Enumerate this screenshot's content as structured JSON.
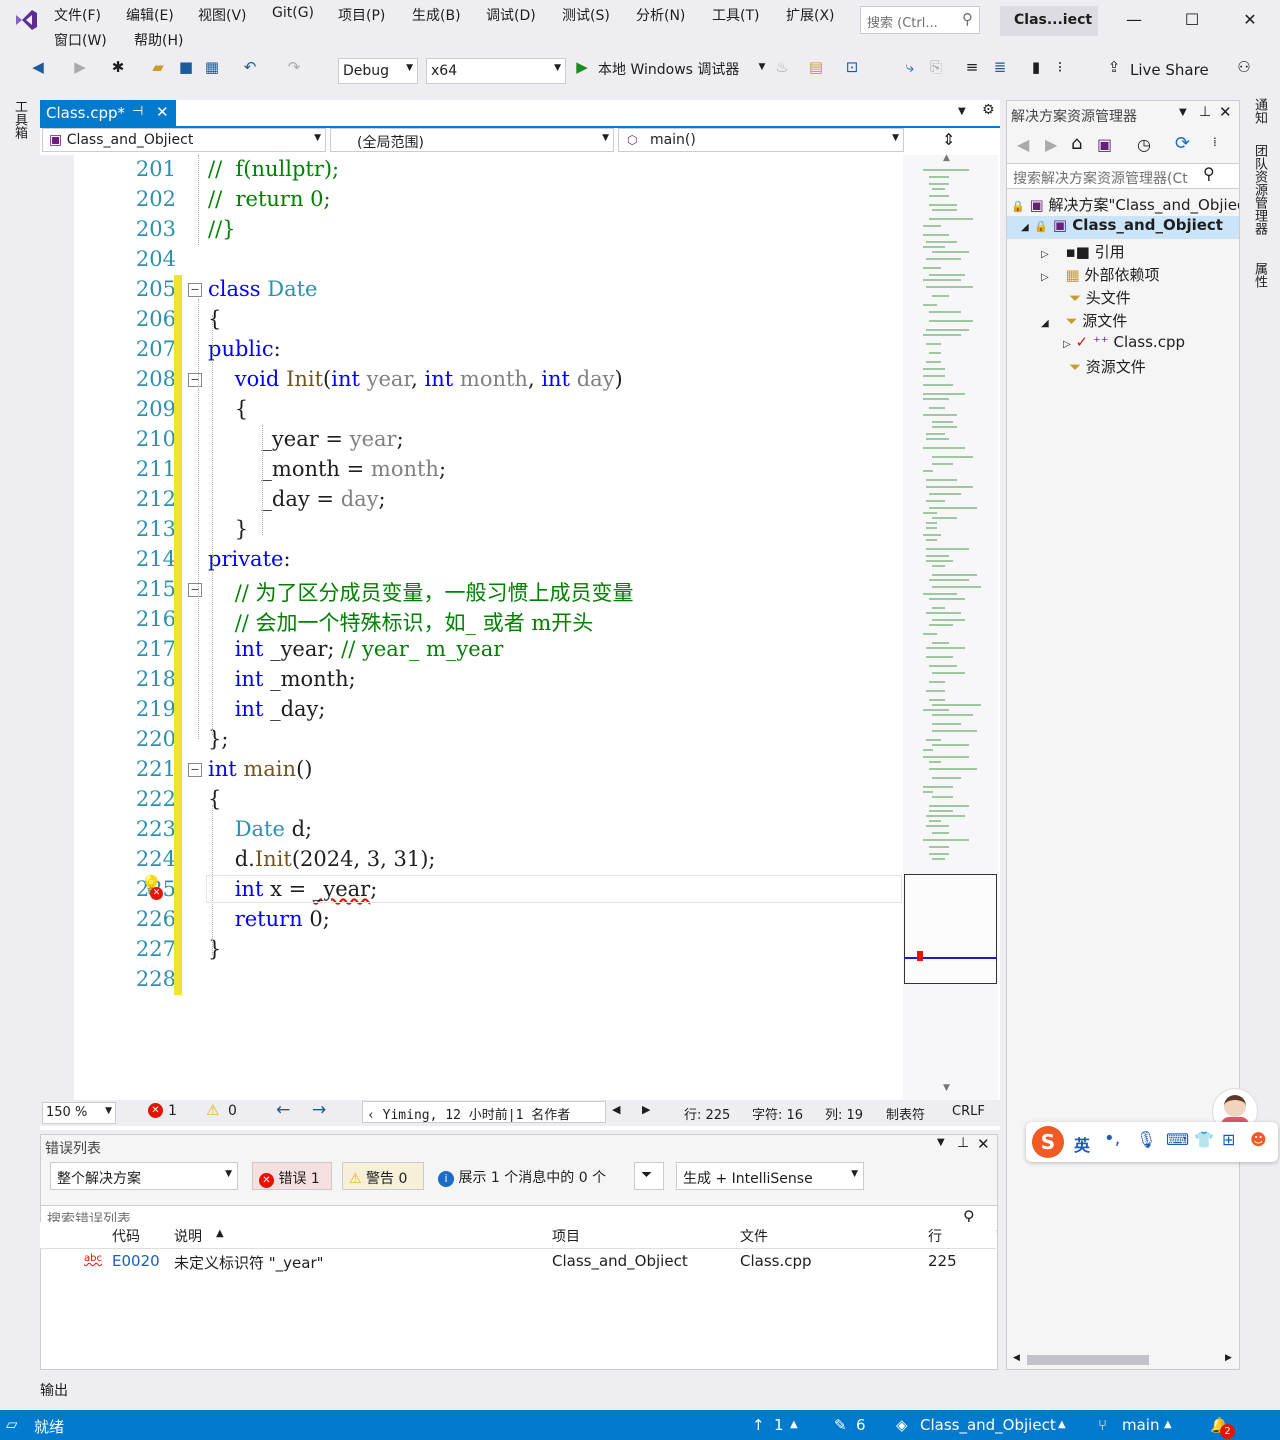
{
  "menu": {
    "items": [
      "文件(F)",
      "编辑(E)",
      "视图(V)",
      "Git(G)",
      "项目(P)",
      "生成(B)",
      "调试(D)",
      "测试(S)",
      "分析(N)",
      "工具(T)",
      "扩展(X)"
    ],
    "row2": [
      "窗口(W)",
      "帮助(H)"
    ],
    "search_placeholder": "搜索 (Ctrl...",
    "title": "Clas...iect"
  },
  "toolbar": {
    "config": "Debug",
    "platform": "x64",
    "run_label": "本地 Windows 调试器",
    "live_share": "Live Share"
  },
  "left_tool": "工具箱",
  "right_strip": [
    "通知",
    "团队资源管理器",
    "属性"
  ],
  "editor": {
    "tab_label": "Class.cpp*",
    "nav_project": "Class_and_Objiect",
    "nav_scope": "(全局范围)",
    "nav_member": "main()",
    "lines": [
      {
        "n": "201",
        "html": "<span class=\"cm\">//  f(nullptr);</span>"
      },
      {
        "n": "202",
        "html": "<span class=\"cm\">//  return 0;</span>"
      },
      {
        "n": "203",
        "html": "<span class=\"cm\">//}</span>"
      },
      {
        "n": "204",
        "html": ""
      },
      {
        "n": "205",
        "html": "<span class=\"kw\">class</span> <span class=\"cls\">Date</span>"
      },
      {
        "n": "206",
        "html": "{"
      },
      {
        "n": "207",
        "html": "<span class=\"kw\">public</span>:"
      },
      {
        "n": "208",
        "html": "    <span class=\"kw\">void</span> <span class=\"fn\">Init</span>(<span class=\"kw\">int</span> <span class=\"pm\">year</span>, <span class=\"kw\">int</span> <span class=\"pm\">month</span>, <span class=\"kw\">int</span> <span class=\"pm\">day</span>)"
      },
      {
        "n": "209",
        "html": "    {"
      },
      {
        "n": "210",
        "html": "        _year = <span class=\"pm\">year</span>;"
      },
      {
        "n": "211",
        "html": "        _month = <span class=\"pm\">month</span>;"
      },
      {
        "n": "212",
        "html": "        _day = <span class=\"pm\">day</span>;"
      },
      {
        "n": "213",
        "html": "    }"
      },
      {
        "n": "214",
        "html": "<span class=\"kw\">private</span>:"
      },
      {
        "n": "215",
        "html": "    <span class=\"cm\">// 为了区分成员变量，一般习惯上成员变量</span>"
      },
      {
        "n": "216",
        "html": "    <span class=\"cm\">// 会加一个特殊标识，如_ 或者 m开头</span>"
      },
      {
        "n": "217",
        "html": "    <span class=\"kw\">int</span> _year; <span class=\"cm\">// year_ m_year</span>"
      },
      {
        "n": "218",
        "html": "    <span class=\"kw\">int</span> _month;"
      },
      {
        "n": "219",
        "html": "    <span class=\"kw\">int</span> _day;"
      },
      {
        "n": "220",
        "html": "};"
      },
      {
        "n": "221",
        "html": "<span class=\"kw\">int</span> <span class=\"fn\">main</span>()"
      },
      {
        "n": "222",
        "html": "{"
      },
      {
        "n": "223",
        "html": "    <span class=\"cls\">Date</span> d;"
      },
      {
        "n": "224",
        "html": "    d.<span class=\"fn\">Init</span>(2024, 3, 31);"
      },
      {
        "n": "225",
        "html": "    <span class=\"kw\">int</span> x = <span class=\"squig\">_year</span>;"
      },
      {
        "n": "226",
        "html": "    <span class=\"kw\">return</span> 0;"
      },
      {
        "n": "227",
        "html": "}"
      },
      {
        "n": "228",
        "html": ""
      }
    ],
    "zoom": "150 %",
    "errors": "1",
    "warnings": "0",
    "codelens": "Yiming, 12 小时前|1 名作者",
    "line": "行: 225",
    "char": "字符: 16",
    "col": "列: 19",
    "tab_mode": "制表符",
    "eol": "CRLF"
  },
  "error_list": {
    "title": "错误列表",
    "scope": "整个解决方案",
    "errors_btn": "错误 1",
    "warnings_btn": "警告 0",
    "messages_btn": "展示 1 个消息中的 0 个",
    "build_filter": "生成 + IntelliSense",
    "search_placeholder": "搜索错误列表",
    "headers": {
      "code": "代码",
      "desc": "说明",
      "project": "项目",
      "file": "文件",
      "line": "行"
    },
    "rows": [
      {
        "code": "E0020",
        "desc": "未定义标识符 \"_year\"",
        "project": "Class_and_Objiect",
        "file": "Class.cpp",
        "line": "225"
      }
    ]
  },
  "output_label": "输出",
  "solution": {
    "title": "解决方案资源管理器",
    "search_placeholder": "搜索解决方案资源管理器(Ct",
    "solution_item": "解决方案\"Class_and_Objiec",
    "project": "Class_and_Objiect",
    "items": [
      "引用",
      "外部依赖项",
      "头文件",
      "源文件",
      "Class.cpp",
      "资源文件"
    ]
  },
  "ime": {
    "lang": "英"
  },
  "statusbar": {
    "ready": "就绪",
    "up": "1",
    "edits": "6",
    "repo": "Class_and_Objiect",
    "branch": "main",
    "notifications": "2"
  }
}
